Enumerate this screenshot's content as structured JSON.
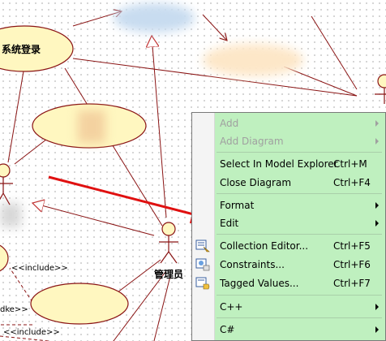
{
  "diagram": {
    "usecase_login": "系统登录",
    "actor_admin": "管理员",
    "include_label_1": "<<include>>",
    "include_label_2": "dke>>",
    "include_label_3": "<<include>>",
    "colors": {
      "usecase_fill": "#fff7c0",
      "usecase_stroke": "#8a1414",
      "association": "#8a1414",
      "generalization_head": "#c03030",
      "arrow": "#e01010"
    }
  },
  "context_menu": {
    "background": "#bff0bf",
    "items": [
      {
        "label": "Add",
        "shortcut": "",
        "submenu": true,
        "enabled": false,
        "icon": ""
      },
      {
        "label": "Add Diagram",
        "shortcut": "",
        "submenu": true,
        "enabled": false,
        "icon": ""
      },
      {
        "label": "Select In Model Explorer",
        "shortcut": "Ctrl+M",
        "submenu": false,
        "enabled": true,
        "icon": ""
      },
      {
        "label": "Close Diagram",
        "shortcut": "Ctrl+F4",
        "submenu": false,
        "enabled": true,
        "icon": ""
      },
      {
        "label": "Format",
        "shortcut": "",
        "submenu": true,
        "enabled": true,
        "icon": ""
      },
      {
        "label": "Edit",
        "shortcut": "",
        "submenu": true,
        "enabled": true,
        "icon": ""
      },
      {
        "label": "Collection Editor...",
        "shortcut": "Ctrl+F5",
        "submenu": false,
        "enabled": true,
        "icon": "collection-editor-icon"
      },
      {
        "label": "Constraints...",
        "shortcut": "Ctrl+F6",
        "submenu": false,
        "enabled": true,
        "icon": "constraints-icon"
      },
      {
        "label": "Tagged Values...",
        "shortcut": "Ctrl+F7",
        "submenu": false,
        "enabled": true,
        "icon": "tagged-values-icon"
      },
      {
        "label": "C++",
        "shortcut": "",
        "submenu": true,
        "enabled": true,
        "icon": ""
      },
      {
        "label": "C#",
        "shortcut": "",
        "submenu": true,
        "enabled": true,
        "icon": ""
      }
    ]
  }
}
